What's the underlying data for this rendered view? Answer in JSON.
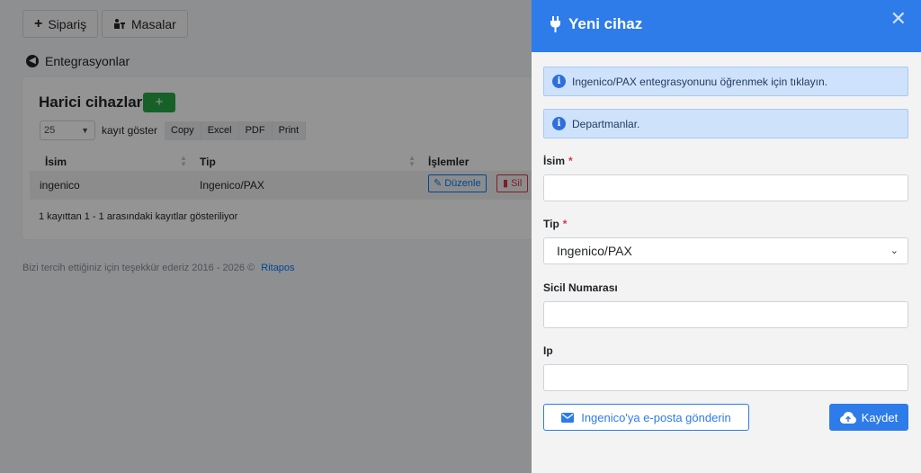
{
  "topbar": {
    "order_label": "Sipariş",
    "order_icon": "+",
    "tables_label": "Masalar",
    "tables_icon": "table-people-icon"
  },
  "breadcrumb": {
    "label": "Entegrasyonlar"
  },
  "card": {
    "title": "Harici cihazlar",
    "add_icon": "+",
    "page_length": "25",
    "page_length_label": "kayıt göster",
    "exports": [
      "Copy",
      "Excel",
      "PDF",
      "Print"
    ],
    "columns": [
      "İsim",
      "Tip",
      "İşlemler"
    ],
    "rows": [
      {
        "name": "ingenico",
        "type": "Ingenico/PAX",
        "edit": "Düzenle",
        "delete": "Sil"
      }
    ],
    "info": "1 kayıttan 1 - 1 arasındaki kayıtlar gösteriliyor"
  },
  "footer": {
    "text": "Bizi tercih ettiğiniz için teşekkür ederiz 2016 - 2026 ©",
    "brand": "Ritapos"
  },
  "panel": {
    "title": "Yeni cihaz",
    "close": "✕",
    "alerts": [
      "Ingenico/PAX entegrasyonunu öğrenmek için tıklayın.",
      "Departmanlar."
    ],
    "fields": {
      "name": {
        "label": "İsim",
        "required": "*",
        "value": ""
      },
      "type": {
        "label": "Tip",
        "required": "*",
        "value": "Ingenico/PAX"
      },
      "serial": {
        "label": "Sicil Numarası",
        "value": ""
      },
      "ip": {
        "label": "Ip",
        "value": ""
      }
    },
    "email_button": "Ingenico'ya e-posta gönderin",
    "save_button": "Kaydet"
  },
  "colors": {
    "primary": "#2e7bea",
    "success": "#28a745",
    "danger": "#dc3545",
    "info_bg": "#cfe2fb"
  }
}
